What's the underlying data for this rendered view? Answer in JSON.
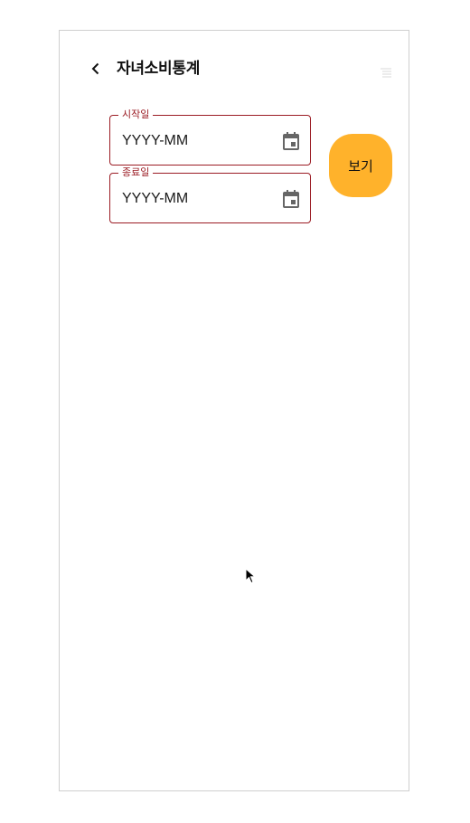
{
  "header": {
    "title": "자녀소비통계",
    "back_icon": "chevron-left-icon",
    "menu_icon": "list-icon"
  },
  "form": {
    "start": {
      "label": "시작일",
      "placeholder": "YYYY-MM",
      "value": "",
      "icon": "calendar-icon"
    },
    "end": {
      "label": "종료일",
      "placeholder": "YYYY-MM",
      "value": "",
      "icon": "calendar-icon"
    },
    "view_button": "보기"
  },
  "colors": {
    "accent": "#ffb22b",
    "field_border": "#9b1c24"
  }
}
